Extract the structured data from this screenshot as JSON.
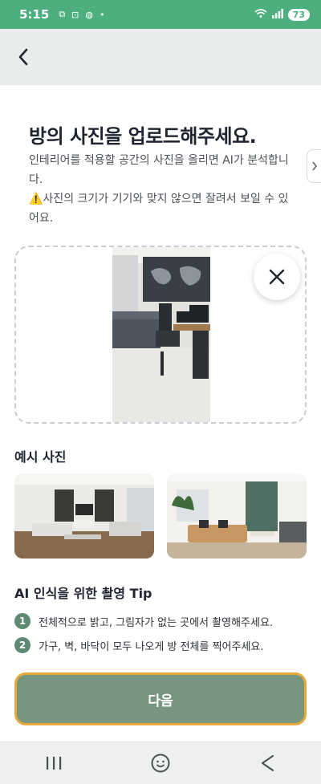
{
  "status_bar": {
    "time": "5:15",
    "battery": "73",
    "accent": "#4caf7d"
  },
  "header": {
    "back_icon": "chevron-left-icon"
  },
  "page": {
    "title": "방의 사진을 업로드해주세요.",
    "desc_line1": "인테리어를 적용할 공간의 사진을 올리면 AI가 분석합니다.",
    "desc_line2": "⚠️사진의 크기가 기기와 맞지 않으면 잘려서 보일 수 있어요."
  },
  "upload": {
    "remove_icon": "close-icon"
  },
  "examples": {
    "title": "예시 사진"
  },
  "tips": {
    "title": "AI 인식을 위한 촬영 Tip",
    "items": [
      {
        "num": "1",
        "text": "전체적으로 밝고, 그림자가 없는 곳에서 촬영해주세요."
      },
      {
        "num": "2",
        "text": "가구, 벽, 바닥이 모두 나오게 방 전체를 찍어주세요."
      }
    ]
  },
  "actions": {
    "next_label": "다음",
    "button_color": "#78967f",
    "border_color": "#e6a93c"
  },
  "nav": {
    "recent_icon": "recent-apps-icon",
    "home_icon": "home-icon",
    "back_icon": "back-icon"
  }
}
